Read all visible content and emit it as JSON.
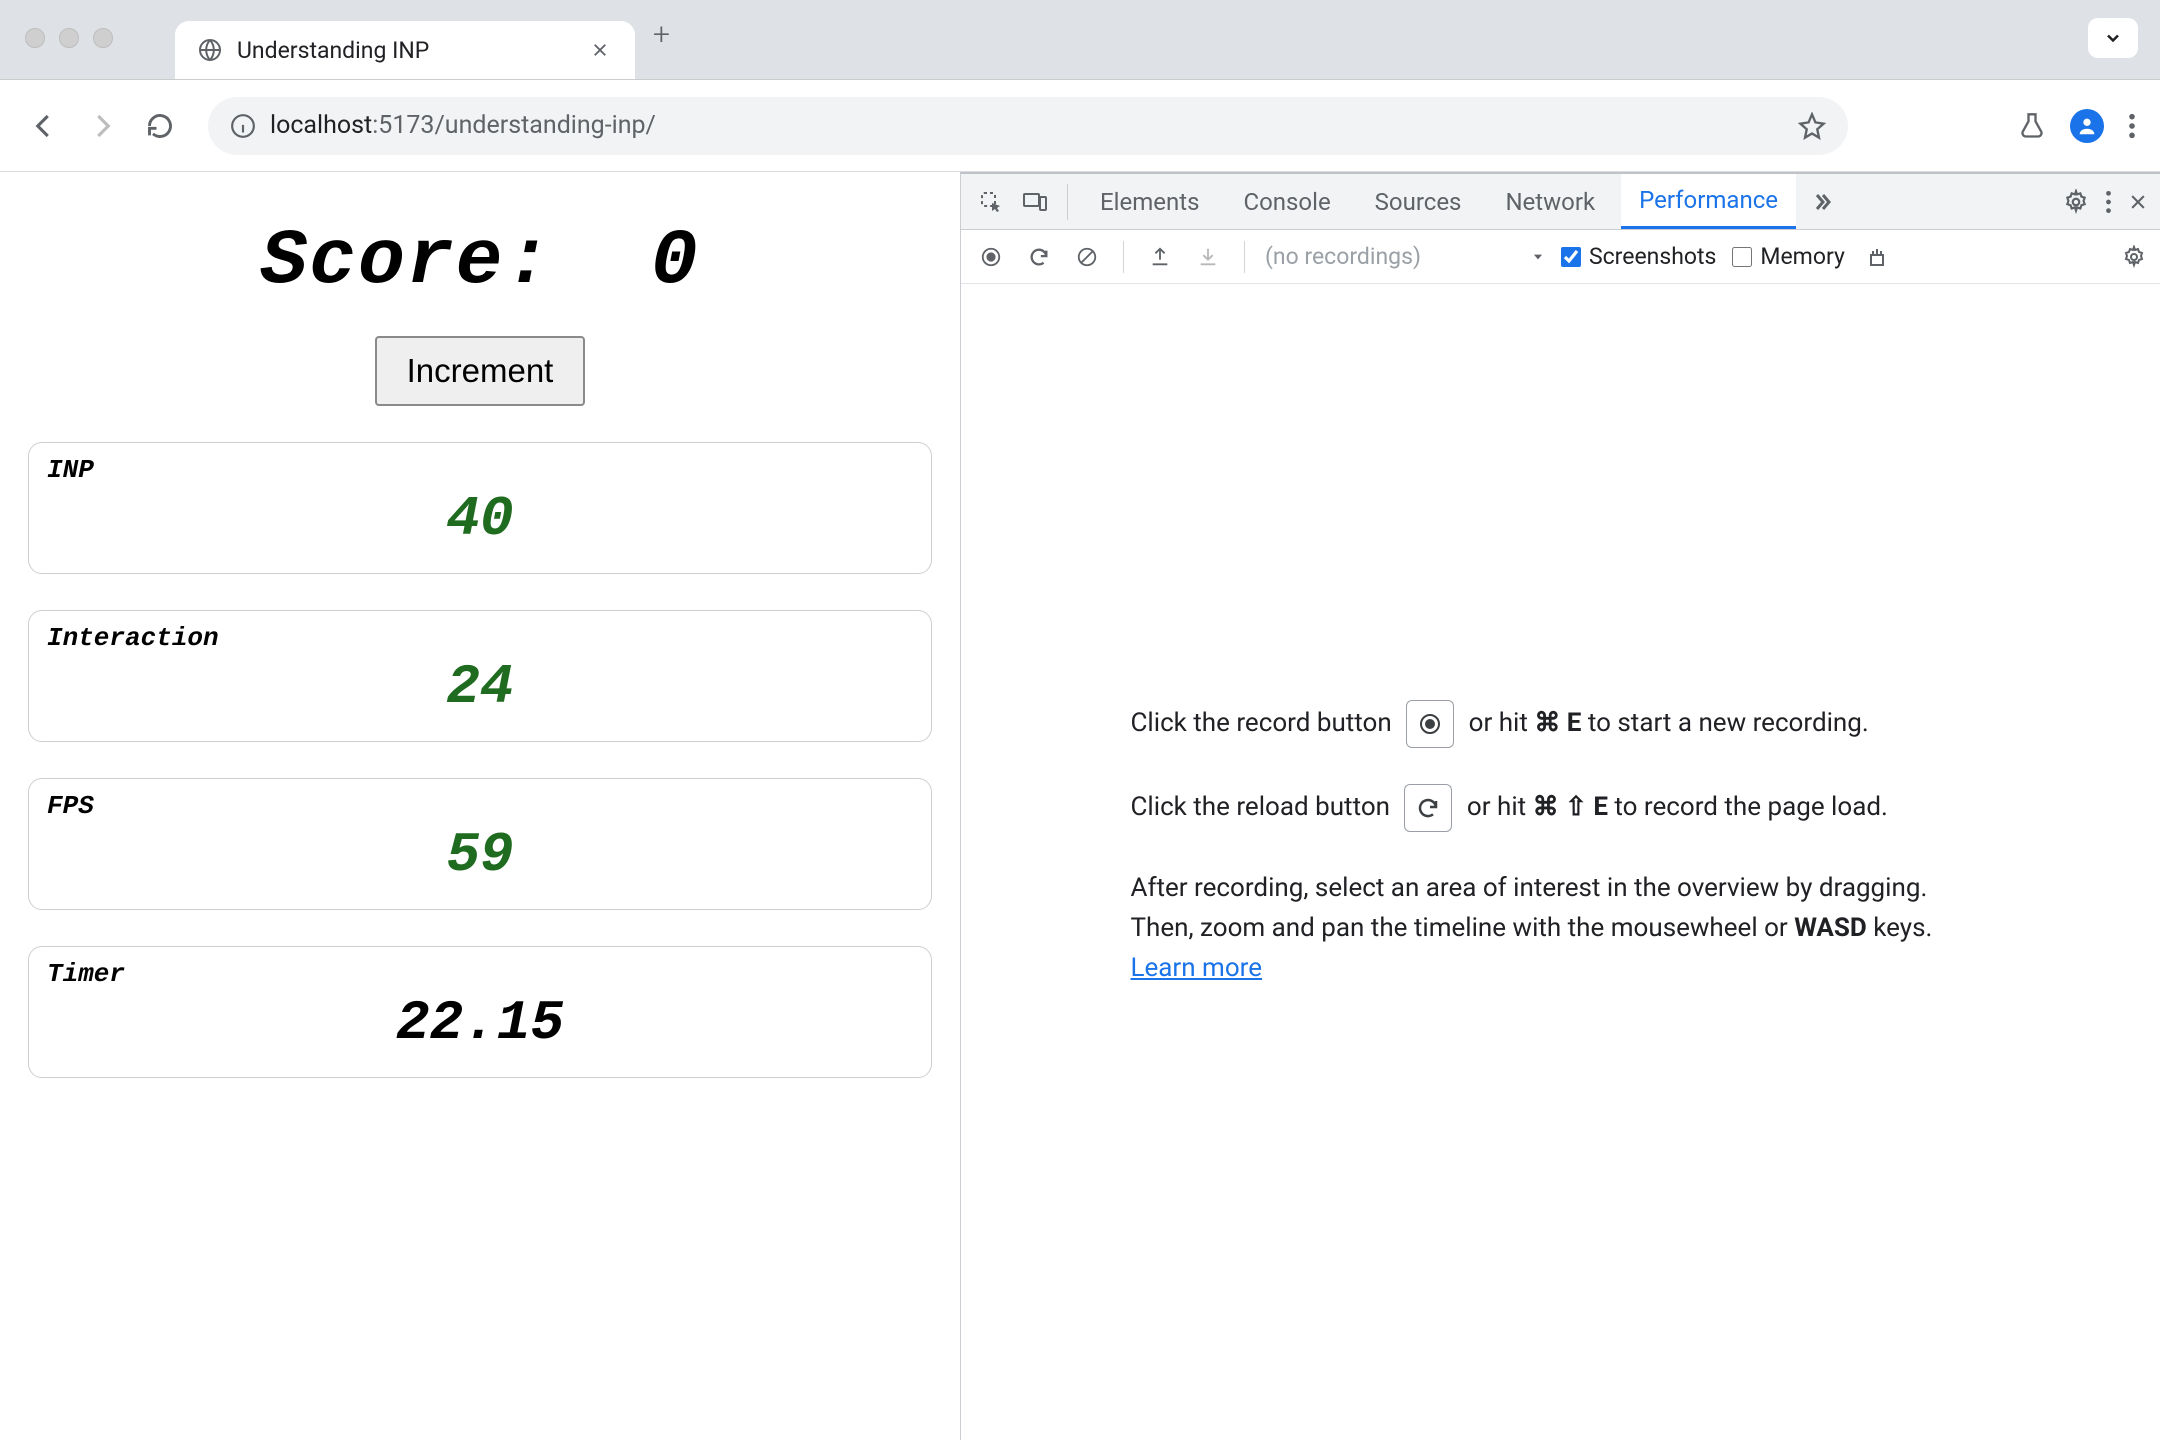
{
  "browser": {
    "tab_title": "Understanding INP",
    "url_host": "localhost",
    "url_port_path": ":5173/understanding-inp/"
  },
  "page": {
    "score_label": "Score:",
    "score_value": "0",
    "increment_label": "Increment",
    "metrics": [
      {
        "label": "INP",
        "value": "40",
        "green": true
      },
      {
        "label": "Interaction",
        "value": "24",
        "green": true
      },
      {
        "label": "FPS",
        "value": "59",
        "green": true
      },
      {
        "label": "Timer",
        "value": "22.15",
        "green": false
      }
    ]
  },
  "devtools": {
    "tabs": [
      "Elements",
      "Console",
      "Sources",
      "Network",
      "Performance"
    ],
    "active_tab": "Performance",
    "toolbar": {
      "recordings_placeholder": "(no recordings)",
      "screenshots_label": "Screenshots",
      "memory_label": "Memory"
    },
    "empty": {
      "line1_a": "Click the record button",
      "line1_b": "or hit",
      "line1_k1": "⌘",
      "line1_k2": "E",
      "line1_c": "to start a new recording.",
      "line2_a": "Click the reload button",
      "line2_b": "or hit",
      "line2_k1": "⌘",
      "line2_k2": "⇧",
      "line2_k3": "E",
      "line2_c": "to record the page load.",
      "line3_a": "After recording, select an area of interest in the overview by dragging. Then, zoom and pan the timeline with the mousewheel or ",
      "line3_wasd": "WASD",
      "line3_b": " keys.",
      "learn_more": "Learn more"
    }
  }
}
